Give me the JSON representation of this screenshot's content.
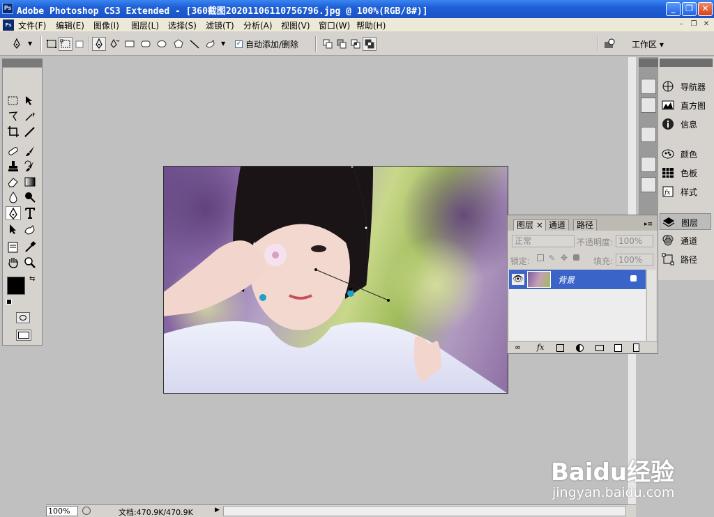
{
  "window": {
    "title": "Adobe Photoshop CS3 Extended - [360截图20201106110756796.jpg @ 100%(RGB/8#)]",
    "controls": [
      "_",
      "❐",
      "✕"
    ]
  },
  "menu": {
    "items": [
      "文件(F)",
      "编辑(E)",
      "图像(I)",
      "图层(L)",
      "选择(S)",
      "滤镜(T)",
      "分析(A)",
      "视图(V)",
      "窗口(W)",
      "帮助(H)"
    ],
    "doc_controls": [
      "–",
      "❐",
      "✕"
    ]
  },
  "options": {
    "auto_add_delete_label": "自动添加/删除",
    "auto_add_delete_checked": "✓",
    "workspace_label": "工作区 ▾"
  },
  "dock": {
    "panels": [
      {
        "label": "导航器",
        "icon": "navigator-icon"
      },
      {
        "label": "直方图",
        "icon": "histogram-icon"
      },
      {
        "label": "信息",
        "icon": "info-icon"
      },
      {
        "label": "颜色",
        "icon": "color-icon"
      },
      {
        "label": "色板",
        "icon": "swatches-icon"
      },
      {
        "label": "样式",
        "icon": "styles-icon"
      },
      {
        "label": "图层",
        "icon": "layers-icon"
      },
      {
        "label": "通道",
        "icon": "channels-icon"
      },
      {
        "label": "路径",
        "icon": "paths-icon"
      }
    ]
  },
  "layers_panel": {
    "tabs": [
      "图层 ×",
      "通道",
      "路径"
    ],
    "blend_mode": "正常",
    "opacity_label": "不透明度:",
    "opacity_value": "100%",
    "lock_label": "锁定:",
    "fill_label": "填充:",
    "fill_value": "100%",
    "layer_name": "背景"
  },
  "status": {
    "zoom": "100%",
    "doc_size": "文档:470.9K/470.9K"
  },
  "watermark": {
    "logo": "Baidu经验",
    "url": "jingyan.baidu.com"
  },
  "colors": {
    "titlebar": "#1f5fd8",
    "panel_bg": "#d6d3ce",
    "selected_layer": "#3b64c8"
  }
}
